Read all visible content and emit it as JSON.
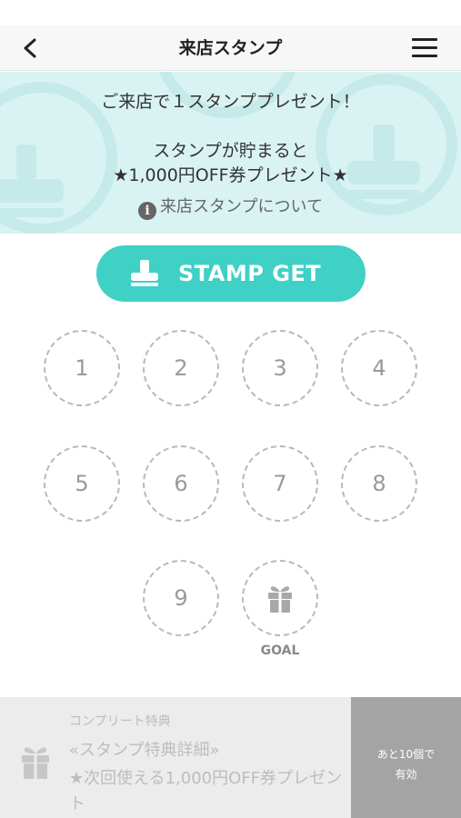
{
  "header": {
    "title": "来店スタンプ"
  },
  "banner": {
    "line1": "ご来店で１スタンププレゼント！",
    "line2": "スタンプが貯まると",
    "line3": "★1,000円OFF券プレゼント★",
    "about_link": "来店スタンプについて"
  },
  "stamp_button": {
    "label": "STAMP GET"
  },
  "stamps": {
    "slots": [
      "1",
      "2",
      "3",
      "4",
      "5",
      "6",
      "7",
      "8",
      "9"
    ],
    "goal_label": "GOAL",
    "collected": 0
  },
  "footer": {
    "caption": "コンプリート特典",
    "title": "«スタンプ特典詳細»",
    "description": "★次回使える1,000円OFF券プレゼント",
    "cta_line1": "あと10個で",
    "cta_line2": "有効"
  },
  "colors": {
    "accent": "#3fd0c6",
    "banner_bg": "#d9f3f3",
    "footer_bg": "#ececec",
    "cta_bg": "#a4a4a4"
  }
}
